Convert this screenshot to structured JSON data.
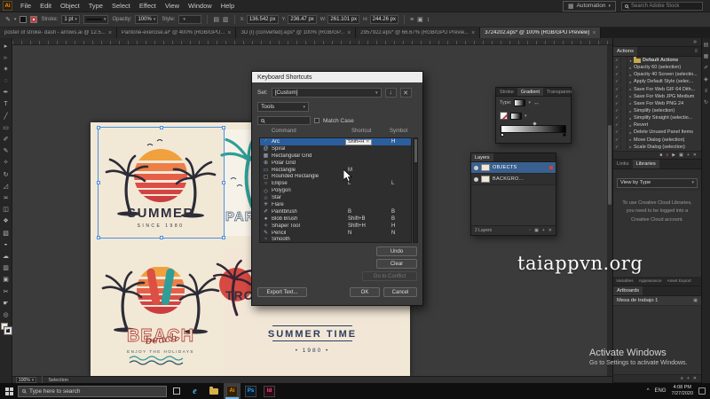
{
  "colors": {
    "accent_blue": "#2b5e9e",
    "cream": "#f2e8d6",
    "sunset_orange": "#f0a13e",
    "sunset_red": "#d64a42",
    "teal": "#2f9e97",
    "navy": "#2c3e5c",
    "ai_orange": "#ff9a00"
  },
  "menubar": {
    "logo": "Ai",
    "items": [
      "File",
      "Edit",
      "Object",
      "Type",
      "Select",
      "Effect",
      "View",
      "Window",
      "Help"
    ],
    "workspace": "Automation",
    "stock_search_placeholder": "Search Adobe Stock"
  },
  "controlbar": {
    "stroke_label": "Stroke:",
    "stroke_value": "1 pt",
    "opacity_label": "Opacity:",
    "opacity_value": "100%",
    "style_label": "Style:",
    "transform_fields": [
      {
        "label": "X:",
        "value": "136.542 px"
      },
      {
        "label": "Y:",
        "value": "236.47 px"
      },
      {
        "label": "W:",
        "value": "261.101 px"
      },
      {
        "label": "H:",
        "value": "244.26 px"
      }
    ]
  },
  "tabs": [
    {
      "label": "poster of stroke- dash - arrows.ai @ 12.5...",
      "active": false
    },
    {
      "label": "Pantoné-exercise.ai* @ 400% (RGB/GPU...",
      "active": false
    },
    {
      "label": "3D (I) (converted).eps* @ 100% (RGB/GP...",
      "active": false
    },
    {
      "label": "2957922.eps* @ 66.67% (RGB/GPU Previe...",
      "active": false
    },
    {
      "label": "3724202.eps* @ 100% (RGB/GPU Preview)",
      "active": true
    }
  ],
  "toolbar": {
    "tools": [
      {
        "name": "selection-tool",
        "glyph": "▸"
      },
      {
        "name": "direct-selection-tool",
        "glyph": "▹"
      },
      {
        "name": "magic-wand-tool",
        "glyph": "✶"
      },
      {
        "name": "lasso-tool",
        "glyph": "◌"
      },
      {
        "name": "pen-tool",
        "glyph": "✒"
      },
      {
        "name": "type-tool",
        "glyph": "T"
      },
      {
        "name": "line-segment-tool",
        "glyph": "╱"
      },
      {
        "name": "rectangle-tool",
        "glyph": "▭"
      },
      {
        "name": "paintbrush-tool",
        "glyph": "✐"
      },
      {
        "name": "pencil-tool",
        "glyph": "✎"
      },
      {
        "name": "shaper-tool",
        "glyph": "✧"
      },
      {
        "name": "rotate-tool",
        "glyph": "↻"
      },
      {
        "name": "scale-tool",
        "glyph": "◿"
      },
      {
        "name": "width-tool",
        "glyph": "≍"
      },
      {
        "name": "free-transform-tool",
        "glyph": "◫"
      },
      {
        "name": "shape-builder-tool",
        "glyph": "❖"
      },
      {
        "name": "gradient-tool",
        "glyph": "▧"
      },
      {
        "name": "eyedropper-tool",
        "glyph": "◒"
      },
      {
        "name": "symbol-sprayer-tool",
        "glyph": "☁"
      },
      {
        "name": "column-graph-tool",
        "glyph": "▥"
      },
      {
        "name": "artboard-tool",
        "glyph": "▣"
      },
      {
        "name": "slice-tool",
        "glyph": "✂"
      },
      {
        "name": "hand-tool",
        "glyph": "☛"
      },
      {
        "name": "zoom-tool",
        "glyph": "◎"
      }
    ]
  },
  "artboard": {
    "poster_summer": {
      "title": "SUMMER",
      "subtitle": "SINCE 1980"
    },
    "poster_paradise": {
      "title": "PARADISE"
    },
    "poster_beach": {
      "title": "BEACH",
      "script": "beach",
      "subtitle": "ENJOY THE HOLIDAYS"
    },
    "poster_tropical": {
      "title": "TROPICAL",
      "line1": "SUMMER TIME",
      "line2": "• 1980 •"
    }
  },
  "dialog": {
    "title": "Keyboard Shortcuts",
    "set_label": "Set:",
    "set_value": "[Custom]",
    "scope_value": "Tools",
    "match_case_label": "Match Case",
    "columns": [
      "Command",
      "Shortcut",
      "Symbol"
    ],
    "rows": [
      {
        "icon": "arc-tool-icon",
        "glyph": "◜",
        "name": "Arc",
        "shortcut": "Shift+H",
        "symbol": "H",
        "selected": true,
        "editing": true
      },
      {
        "icon": "spiral-tool-icon",
        "glyph": "@",
        "name": "Spiral",
        "shortcut": "",
        "symbol": ""
      },
      {
        "icon": "rectangular-grid-tool-icon",
        "glyph": "▦",
        "name": "Rectangular Grid",
        "shortcut": "",
        "symbol": ""
      },
      {
        "icon": "polar-grid-tool-icon",
        "glyph": "⊕",
        "name": "Polar Grid",
        "shortcut": "",
        "symbol": ""
      },
      {
        "icon": "rectangle-tool-icon",
        "glyph": "▭",
        "name": "Rectangle",
        "shortcut": "M",
        "symbol": ""
      },
      {
        "icon": "rounded-rectangle-tool-icon",
        "glyph": "▢",
        "name": "Rounded Rectangle",
        "shortcut": "",
        "symbol": ""
      },
      {
        "icon": "ellipse-tool-icon",
        "glyph": "○",
        "name": "Ellipse",
        "shortcut": "L",
        "symbol": "L"
      },
      {
        "icon": "polygon-tool-icon",
        "glyph": "◇",
        "name": "Polygon",
        "shortcut": "",
        "symbol": ""
      },
      {
        "icon": "star-tool-icon",
        "glyph": "☆",
        "name": "Star",
        "shortcut": "",
        "symbol": ""
      },
      {
        "icon": "flare-tool-icon",
        "glyph": "✳",
        "name": "Flare",
        "shortcut": "",
        "symbol": ""
      },
      {
        "icon": "paintbrush-tool-icon",
        "glyph": "✐",
        "name": "Paintbrush",
        "shortcut": "B",
        "symbol": "B"
      },
      {
        "icon": "blob-brush-tool-icon",
        "glyph": "●",
        "name": "Blob Brush",
        "shortcut": "Shift+B",
        "symbol": "B"
      },
      {
        "icon": "shaper-tool-icon",
        "glyph": "✧",
        "name": "Shaper Tool",
        "shortcut": "Shift+H",
        "symbol": "H"
      },
      {
        "icon": "pencil-tool-icon",
        "glyph": "✎",
        "name": "Pencil",
        "shortcut": "N",
        "symbol": "N"
      },
      {
        "icon": "smooth-tool-icon",
        "glyph": "~",
        "name": "Smooth",
        "shortcut": "",
        "symbol": ""
      }
    ],
    "buttons": {
      "undo": "Undo",
      "clear": "Clear",
      "go_to_conflict": "Go to Conflict",
      "export_text": "Export Text...",
      "ok": "OK",
      "cancel": "Cancel"
    }
  },
  "gradient_panel": {
    "tabs": [
      "Stroke",
      "Gradient",
      "Transparen"
    ],
    "active_tab": "Gradient",
    "type_label": "Type:"
  },
  "layers_panel": {
    "tab": "Layers",
    "rows": [
      {
        "name": "OBJECTS",
        "selected": true
      },
      {
        "name": "BACKGRO...",
        "selected": false
      }
    ],
    "status": "2 Layers",
    "foot_icons": [
      {
        "name": "make-clip-mask-icon",
        "glyph": "▫"
      },
      {
        "name": "new-sublayer-icon",
        "glyph": "▣"
      },
      {
        "name": "new-layer-icon",
        "glyph": "+"
      },
      {
        "name": "delete-layer-icon",
        "glyph": "✕"
      }
    ]
  },
  "dock": {
    "collapse_icon": "»",
    "actions": {
      "tab": "Actions",
      "menu_icon": "≡",
      "items": [
        "Default Actions",
        "Opacity 60 (selection)",
        "Opacity 40 Screen (selectio...",
        "Apply Default Style (selec...",
        "Save For Web GIF 64 Dith...",
        "Save For Web JPG Medium",
        "Save For Web PNG 24",
        "Simplify (selection)",
        "Simplify Straight (selectio...",
        "Revert",
        "Delete Unused Panel Items",
        "Move Dialog (selection)",
        "Scale Dialog (selection)"
      ],
      "toolbar_icons": [
        {
          "name": "stop-icon",
          "glyph": "■"
        },
        {
          "name": "record-icon",
          "glyph": "●"
        },
        {
          "name": "play-icon",
          "glyph": "▶"
        },
        {
          "name": "new-set-icon",
          "glyph": "▣"
        },
        {
          "name": "new-action-icon",
          "glyph": "+"
        },
        {
          "name": "delete-action-icon",
          "glyph": "✕"
        }
      ]
    },
    "libraries": {
      "tabs": [
        "Links",
        "Libraries"
      ],
      "active_tab": "Libraries",
      "view_by": "View by Type",
      "message": "To use Creative Cloud Libraries, you need to be logged into a Creative Cloud account."
    },
    "lower_tabs": [
      "Variables",
      "Appearance",
      "Asset Export"
    ],
    "artboards": {
      "tab": "Artboards",
      "items": [
        "Mesa de trabajo 1"
      ],
      "foot_icons": [
        {
          "name": "rearrange-artboards-icon",
          "glyph": "≡"
        },
        {
          "name": "new-artboard-icon",
          "glyph": "+"
        },
        {
          "name": "delete-artboard-icon",
          "glyph": "✕"
        }
      ]
    }
  },
  "dock_strip": {
    "icons": [
      {
        "name": "color-panel-icon",
        "glyph": "▤"
      },
      {
        "name": "swatches-panel-icon",
        "glyph": "▦"
      },
      {
        "name": "brushes-panel-icon",
        "glyph": "✐"
      },
      {
        "name": "symbols-panel-icon",
        "glyph": "◈"
      },
      {
        "name": "stroke-panel-icon",
        "glyph": "≡"
      },
      {
        "name": "history-panel-icon",
        "glyph": "↻"
      }
    ]
  },
  "watermark": "taiappvn.org",
  "activate": {
    "line1": "Activate Windows",
    "line2": "Go to Settings to activate Windows."
  },
  "statusbar": {
    "zoom": "100%",
    "tool": "Selection"
  },
  "taskbar": {
    "search_placeholder": "Type here to search",
    "apps": [
      {
        "name": "edge",
        "glyph": "e",
        "color": "#4fb6e0",
        "box": false,
        "active": false
      },
      {
        "name": "file-explorer",
        "glyph": "",
        "color": "#d8b04a",
        "box": false,
        "active": false
      },
      {
        "name": "illustrator",
        "glyph": "Ai",
        "color": "#ff9a00",
        "bg": "#30200a",
        "box": true,
        "active": true
      },
      {
        "name": "photoshop",
        "glyph": "Ps",
        "color": "#31a8ff",
        "bg": "#0a1a2a",
        "box": true,
        "active": false
      },
      {
        "name": "indesign",
        "glyph": "Id",
        "color": "#ff4f8b",
        "bg": "#2a0a16",
        "box": true,
        "active": false
      }
    ],
    "tray_expand": "^",
    "lang": "ENG",
    "time": "4:08 PM",
    "date": "7/27/2020"
  }
}
